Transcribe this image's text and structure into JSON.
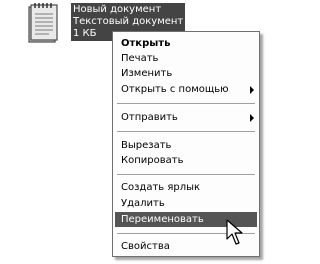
{
  "file": {
    "icon": "notepad-document-icon",
    "name": "Новый документ",
    "type": "Текстовый документ",
    "size": "1 КБ"
  },
  "menu": {
    "items": [
      {
        "label": "Открыть",
        "bold": true
      },
      {
        "label": "Печать"
      },
      {
        "label": "Изменить"
      },
      {
        "label": "Открыть с помощью",
        "submenu": true
      },
      {
        "label": "Отправить",
        "submenu": true
      },
      {
        "label": "Вырезать"
      },
      {
        "label": "Копировать"
      },
      {
        "label": "Создать ярлык"
      },
      {
        "label": "Удалить"
      },
      {
        "label": "Переименовать",
        "highlighted": true
      },
      {
        "label": "Свойства"
      }
    ]
  },
  "colors": {
    "highlight": "#555555",
    "selection": "#444444"
  },
  "cursor_icon": "arrow-cursor-icon"
}
